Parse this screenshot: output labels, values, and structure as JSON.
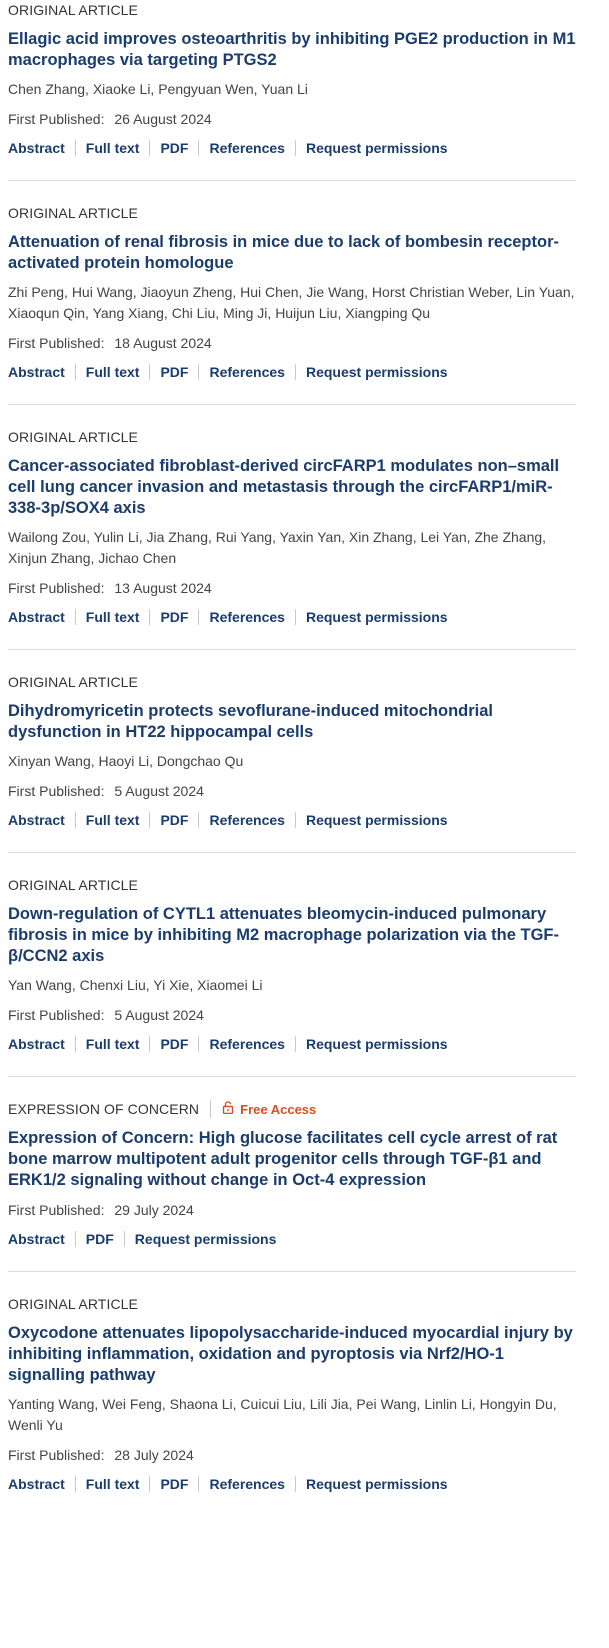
{
  "articles": [
    {
      "type": "ORIGINAL ARTICLE",
      "title": "Ellagic acid improves osteoarthritis by inhibiting PGE2 production in M1 macrophages via targeting PTGS2",
      "authors": "Chen Zhang, Xiaoke Li, Pengyuan Wen, Yuan Li",
      "published_label": "First Published:",
      "published_date": "26 August 2024",
      "links": [
        "Abstract",
        "Full text",
        "PDF",
        "References",
        "Request permissions"
      ]
    },
    {
      "type": "ORIGINAL ARTICLE",
      "title": "Attenuation of renal fibrosis in mice due to lack of bombesin receptor-activated protein homologue",
      "authors": "Zhi Peng, Hui Wang, Jiaoyun Zheng, Hui Chen, Jie Wang, Horst Christian Weber, Lin Yuan, Xiaoqun Qin, Yang Xiang, Chi Liu, Ming Ji, Huijun Liu, Xiangping Qu",
      "published_label": "First Published:",
      "published_date": "18 August 2024",
      "links": [
        "Abstract",
        "Full text",
        "PDF",
        "References",
        "Request permissions"
      ]
    },
    {
      "type": "ORIGINAL ARTICLE",
      "title": "Cancer-associated fibroblast-derived circFARP1 modulates non–small cell lung cancer invasion and metastasis through the circFARP1/miR-338-3p/SOX4 axis",
      "authors": "Wailong Zou, Yulin Li, Jia Zhang, Rui Yang, Yaxin Yan, Xin Zhang, Lei Yan, Zhe Zhang, Xinjun Zhang, Jichao Chen",
      "published_label": "First Published:",
      "published_date": "13 August 2024",
      "links": [
        "Abstract",
        "Full text",
        "PDF",
        "References",
        "Request permissions"
      ]
    },
    {
      "type": "ORIGINAL ARTICLE",
      "title": "Dihydromyricetin protects sevoflurane-induced mitochondrial dysfunction in HT22 hippocampal cells",
      "authors": "Xinyan Wang, Haoyi Li, Dongchao Qu",
      "published_label": "First Published:",
      "published_date": "5 August 2024",
      "links": [
        "Abstract",
        "Full text",
        "PDF",
        "References",
        "Request permissions"
      ]
    },
    {
      "type": "ORIGINAL ARTICLE",
      "title": "Down-regulation of CYTL1 attenuates bleomycin-induced pulmonary fibrosis in mice by inhibiting M2 macrophage polarization via the TGF-β/CCN2 axis",
      "authors": "Yan Wang, Chenxi Liu, Yi Xie, Xiaomei Li",
      "published_label": "First Published:",
      "published_date": "5 August 2024",
      "links": [
        "Abstract",
        "Full text",
        "PDF",
        "References",
        "Request permissions"
      ]
    },
    {
      "type": "EXPRESSION OF CONCERN",
      "access": "Free Access",
      "title": "Expression of Concern: High glucose facilitates cell cycle arrest of rat bone marrow multipotent adult progenitor cells through TGF-β1 and ERK1/2 signaling without change in Oct-4 expression",
      "authors": "",
      "published_label": "First Published:",
      "published_date": "29 July 2024",
      "links": [
        "Abstract",
        "PDF",
        "Request permissions"
      ]
    },
    {
      "type": "ORIGINAL ARTICLE",
      "title": "Oxycodone attenuates lipopolysaccharide-induced myocardial injury by inhibiting inflammation, oxidation and pyroptosis via Nrf2/HO-1 signalling pathway",
      "authors": "Yanting Wang, Wei Feng, Shaona Li, Cuicui Liu, Lili Jia, Pei Wang, Linlin Li, Hongyin Du, Wenli Yu",
      "published_label": "First Published:",
      "published_date": "28 July 2024",
      "links": [
        "Abstract",
        "Full text",
        "PDF",
        "References",
        "Request permissions"
      ]
    }
  ],
  "colors": {
    "link": "#1a3c6e",
    "free_access": "#d64e24",
    "divider": "#dcdcdc"
  },
  "icons": {
    "free_access": "unlock-icon"
  }
}
